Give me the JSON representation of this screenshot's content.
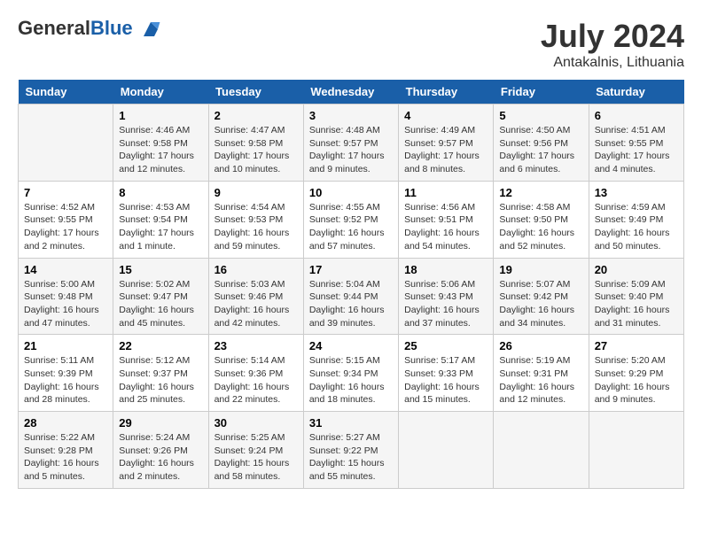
{
  "header": {
    "logo_general": "General",
    "logo_blue": "Blue",
    "main_title": "July 2024",
    "subtitle": "Antakalnis, Lithuania"
  },
  "calendar": {
    "days_of_week": [
      "Sunday",
      "Monday",
      "Tuesday",
      "Wednesday",
      "Thursday",
      "Friday",
      "Saturday"
    ],
    "weeks": [
      [
        {
          "day": "",
          "sunrise": "",
          "sunset": "",
          "daylight": ""
        },
        {
          "day": "1",
          "sunrise": "Sunrise: 4:46 AM",
          "sunset": "Sunset: 9:58 PM",
          "daylight": "Daylight: 17 hours and 12 minutes."
        },
        {
          "day": "2",
          "sunrise": "Sunrise: 4:47 AM",
          "sunset": "Sunset: 9:58 PM",
          "daylight": "Daylight: 17 hours and 10 minutes."
        },
        {
          "day": "3",
          "sunrise": "Sunrise: 4:48 AM",
          "sunset": "Sunset: 9:57 PM",
          "daylight": "Daylight: 17 hours and 9 minutes."
        },
        {
          "day": "4",
          "sunrise": "Sunrise: 4:49 AM",
          "sunset": "Sunset: 9:57 PM",
          "daylight": "Daylight: 17 hours and 8 minutes."
        },
        {
          "day": "5",
          "sunrise": "Sunrise: 4:50 AM",
          "sunset": "Sunset: 9:56 PM",
          "daylight": "Daylight: 17 hours and 6 minutes."
        },
        {
          "day": "6",
          "sunrise": "Sunrise: 4:51 AM",
          "sunset": "Sunset: 9:55 PM",
          "daylight": "Daylight: 17 hours and 4 minutes."
        }
      ],
      [
        {
          "day": "7",
          "sunrise": "Sunrise: 4:52 AM",
          "sunset": "Sunset: 9:55 PM",
          "daylight": "Daylight: 17 hours and 2 minutes."
        },
        {
          "day": "8",
          "sunrise": "Sunrise: 4:53 AM",
          "sunset": "Sunset: 9:54 PM",
          "daylight": "Daylight: 17 hours and 1 minute."
        },
        {
          "day": "9",
          "sunrise": "Sunrise: 4:54 AM",
          "sunset": "Sunset: 9:53 PM",
          "daylight": "Daylight: 16 hours and 59 minutes."
        },
        {
          "day": "10",
          "sunrise": "Sunrise: 4:55 AM",
          "sunset": "Sunset: 9:52 PM",
          "daylight": "Daylight: 16 hours and 57 minutes."
        },
        {
          "day": "11",
          "sunrise": "Sunrise: 4:56 AM",
          "sunset": "Sunset: 9:51 PM",
          "daylight": "Daylight: 16 hours and 54 minutes."
        },
        {
          "day": "12",
          "sunrise": "Sunrise: 4:58 AM",
          "sunset": "Sunset: 9:50 PM",
          "daylight": "Daylight: 16 hours and 52 minutes."
        },
        {
          "day": "13",
          "sunrise": "Sunrise: 4:59 AM",
          "sunset": "Sunset: 9:49 PM",
          "daylight": "Daylight: 16 hours and 50 minutes."
        }
      ],
      [
        {
          "day": "14",
          "sunrise": "Sunrise: 5:00 AM",
          "sunset": "Sunset: 9:48 PM",
          "daylight": "Daylight: 16 hours and 47 minutes."
        },
        {
          "day": "15",
          "sunrise": "Sunrise: 5:02 AM",
          "sunset": "Sunset: 9:47 PM",
          "daylight": "Daylight: 16 hours and 45 minutes."
        },
        {
          "day": "16",
          "sunrise": "Sunrise: 5:03 AM",
          "sunset": "Sunset: 9:46 PM",
          "daylight": "Daylight: 16 hours and 42 minutes."
        },
        {
          "day": "17",
          "sunrise": "Sunrise: 5:04 AM",
          "sunset": "Sunset: 9:44 PM",
          "daylight": "Daylight: 16 hours and 39 minutes."
        },
        {
          "day": "18",
          "sunrise": "Sunrise: 5:06 AM",
          "sunset": "Sunset: 9:43 PM",
          "daylight": "Daylight: 16 hours and 37 minutes."
        },
        {
          "day": "19",
          "sunrise": "Sunrise: 5:07 AM",
          "sunset": "Sunset: 9:42 PM",
          "daylight": "Daylight: 16 hours and 34 minutes."
        },
        {
          "day": "20",
          "sunrise": "Sunrise: 5:09 AM",
          "sunset": "Sunset: 9:40 PM",
          "daylight": "Daylight: 16 hours and 31 minutes."
        }
      ],
      [
        {
          "day": "21",
          "sunrise": "Sunrise: 5:11 AM",
          "sunset": "Sunset: 9:39 PM",
          "daylight": "Daylight: 16 hours and 28 minutes."
        },
        {
          "day": "22",
          "sunrise": "Sunrise: 5:12 AM",
          "sunset": "Sunset: 9:37 PM",
          "daylight": "Daylight: 16 hours and 25 minutes."
        },
        {
          "day": "23",
          "sunrise": "Sunrise: 5:14 AM",
          "sunset": "Sunset: 9:36 PM",
          "daylight": "Daylight: 16 hours and 22 minutes."
        },
        {
          "day": "24",
          "sunrise": "Sunrise: 5:15 AM",
          "sunset": "Sunset: 9:34 PM",
          "daylight": "Daylight: 16 hours and 18 minutes."
        },
        {
          "day": "25",
          "sunrise": "Sunrise: 5:17 AM",
          "sunset": "Sunset: 9:33 PM",
          "daylight": "Daylight: 16 hours and 15 minutes."
        },
        {
          "day": "26",
          "sunrise": "Sunrise: 5:19 AM",
          "sunset": "Sunset: 9:31 PM",
          "daylight": "Daylight: 16 hours and 12 minutes."
        },
        {
          "day": "27",
          "sunrise": "Sunrise: 5:20 AM",
          "sunset": "Sunset: 9:29 PM",
          "daylight": "Daylight: 16 hours and 9 minutes."
        }
      ],
      [
        {
          "day": "28",
          "sunrise": "Sunrise: 5:22 AM",
          "sunset": "Sunset: 9:28 PM",
          "daylight": "Daylight: 16 hours and 5 minutes."
        },
        {
          "day": "29",
          "sunrise": "Sunrise: 5:24 AM",
          "sunset": "Sunset: 9:26 PM",
          "daylight": "Daylight: 16 hours and 2 minutes."
        },
        {
          "day": "30",
          "sunrise": "Sunrise: 5:25 AM",
          "sunset": "Sunset: 9:24 PM",
          "daylight": "Daylight: 15 hours and 58 minutes."
        },
        {
          "day": "31",
          "sunrise": "Sunrise: 5:27 AM",
          "sunset": "Sunset: 9:22 PM",
          "daylight": "Daylight: 15 hours and 55 minutes."
        },
        {
          "day": "",
          "sunrise": "",
          "sunset": "",
          "daylight": ""
        },
        {
          "day": "",
          "sunrise": "",
          "sunset": "",
          "daylight": ""
        },
        {
          "day": "",
          "sunrise": "",
          "sunset": "",
          "daylight": ""
        }
      ]
    ]
  }
}
